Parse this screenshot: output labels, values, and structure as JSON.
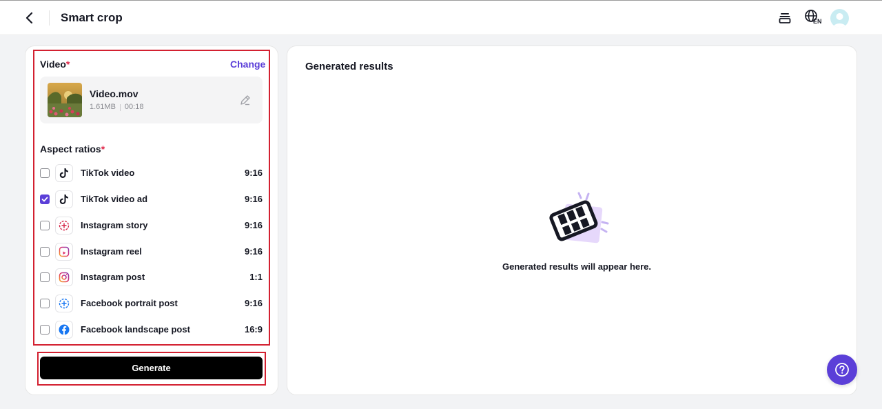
{
  "header": {
    "title": "Smart crop",
    "language_code": "EN"
  },
  "video_section": {
    "title": "Video",
    "required_mark": "*",
    "change_label": "Change",
    "file": {
      "name": "Video.mov",
      "size": "1.61MB",
      "duration": "00:18"
    }
  },
  "aspect_section": {
    "title": "Aspect ratios",
    "required_mark": "*",
    "items": [
      {
        "label": "TikTok video",
        "ratio": "9:16",
        "checked": false,
        "icon": "tiktok-icon"
      },
      {
        "label": "TikTok video ad",
        "ratio": "9:16",
        "checked": true,
        "icon": "tiktok-icon"
      },
      {
        "label": "Instagram story",
        "ratio": "9:16",
        "checked": false,
        "icon": "instagram-story-icon"
      },
      {
        "label": "Instagram reel",
        "ratio": "9:16",
        "checked": false,
        "icon": "instagram-reel-icon"
      },
      {
        "label": "Instagram post",
        "ratio": "1:1",
        "checked": false,
        "icon": "instagram-icon"
      },
      {
        "label": "Facebook portrait post",
        "ratio": "9:16",
        "checked": false,
        "icon": "facebook-story-icon"
      },
      {
        "label": "Facebook landscape post",
        "ratio": "16:9",
        "checked": false,
        "icon": "facebook-icon"
      }
    ]
  },
  "generate_label": "Generate",
  "results": {
    "title": "Generated results",
    "empty_text": "Generated results will appear here."
  },
  "colors": {
    "accent": "#5b3fd8",
    "required": "#e0284a",
    "highlight": "#d32030"
  }
}
